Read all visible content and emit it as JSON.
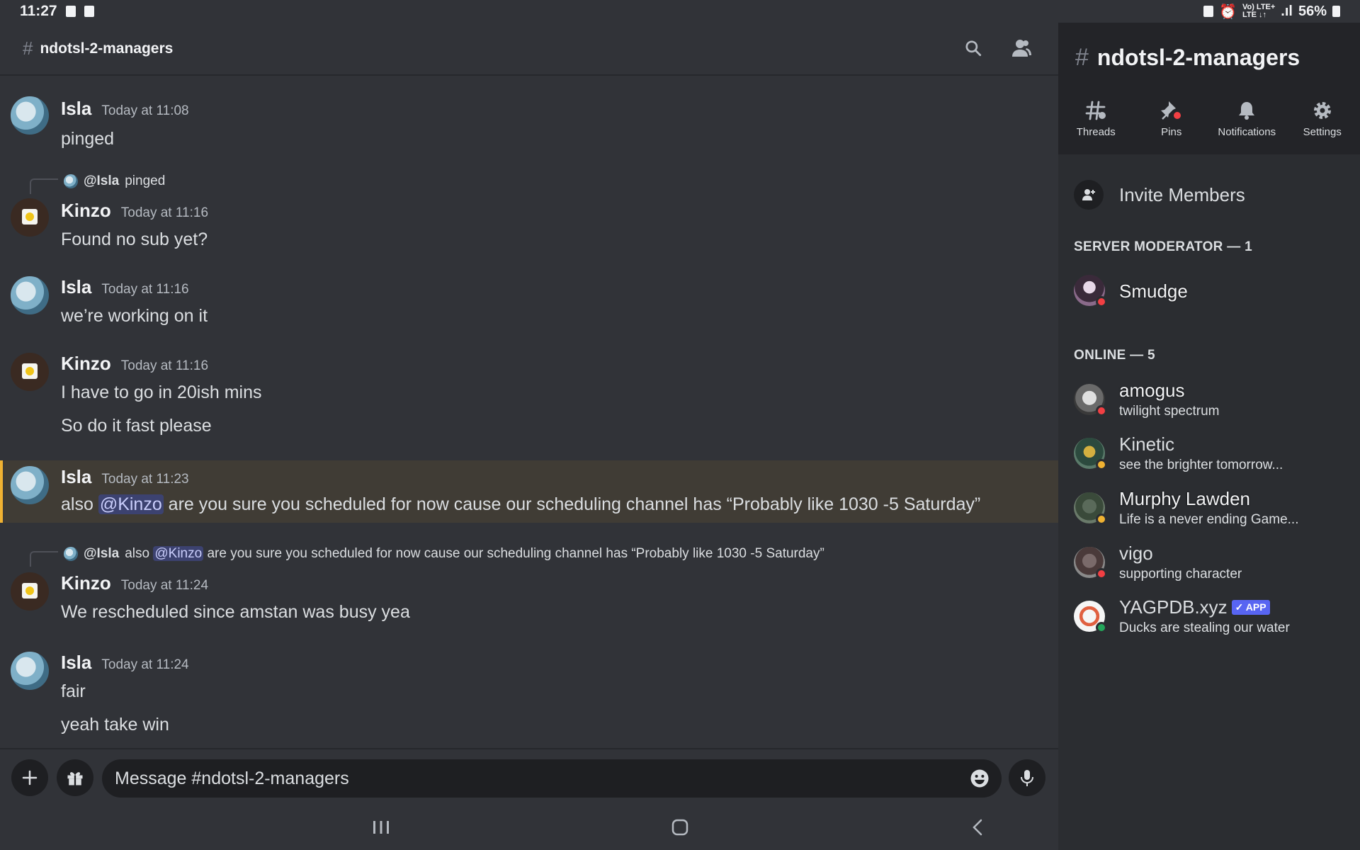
{
  "statusbar": {
    "time": "11:27",
    "battery": "56%",
    "net_small_top": "Vo) LTE+",
    "net_small_bottom": "LTE ↓↑"
  },
  "channel": {
    "name": "ndotsl-2-managers"
  },
  "messages": [
    {
      "user": "Isla",
      "time": "Today at 11:08",
      "lines": [
        "pinged"
      ]
    },
    {
      "reply_to": {
        "user": "@Isla",
        "text": "pinged"
      },
      "user": "Kinzo",
      "time": "Today at 11:16",
      "lines": [
        "Found no sub yet?"
      ]
    },
    {
      "user": "Isla",
      "time": "Today at 11:16",
      "lines": [
        "we’re working on it"
      ]
    },
    {
      "user": "Kinzo",
      "time": "Today at 11:16",
      "lines": [
        "I have to go in 20ish mins",
        "So do it fast please"
      ]
    },
    {
      "user": "Isla",
      "time": "Today at 11:23",
      "pre": "also ",
      "mention": "@Kinzo",
      "post": " are you sure you scheduled for now cause our scheduling channel has “Probably like 1030 -5 Saturday”"
    },
    {
      "reply_to": {
        "user": "@Isla",
        "pre": "also ",
        "mention": "@Kinzo",
        "post": " are you sure you scheduled for now cause our scheduling channel has “Probably like 1030 -5 Saturday”"
      },
      "user": "Kinzo",
      "time": "Today at 11:24",
      "lines": [
        "We rescheduled since amstan was busy yea"
      ]
    },
    {
      "user": "Isla",
      "time": "Today at 11:24",
      "lines": [
        "fair",
        "yeah take win"
      ]
    }
  ],
  "composer": {
    "placeholder": "Message #ndotsl-2-managers"
  },
  "panel": {
    "title": "ndotsl-2-managers",
    "tabs": [
      "Threads",
      "Pins",
      "Notifications",
      "Settings"
    ],
    "invite": "Invite Members",
    "sections": [
      {
        "title": "SERVER MODERATOR — 1",
        "members": [
          {
            "name": "Smudge",
            "status": "dnd",
            "sub": ""
          }
        ]
      },
      {
        "title": "ONLINE — 5",
        "members": [
          {
            "name": "amogus",
            "status": "dnd",
            "sub": "twilight spectrum"
          },
          {
            "name": "Kinetic",
            "status": "idle",
            "sub": "see the brighter tomorrow..."
          },
          {
            "name": "Murphy Lawden",
            "status": "idle",
            "sub": "Life is a never ending Game..."
          },
          {
            "name": "vigo",
            "status": "dnd",
            "sub": "supporting character"
          },
          {
            "name": "YAGPDB.xyz",
            "badge": "✓ APP",
            "status": "online",
            "sub": "Ducks are stealing our water"
          }
        ]
      }
    ]
  },
  "colors": {
    "background": "#313338",
    "panel": "#2b2d31",
    "highlight": "#403c35",
    "highlight_bar": "#f0b232",
    "mention_bg": "#3c4270"
  }
}
